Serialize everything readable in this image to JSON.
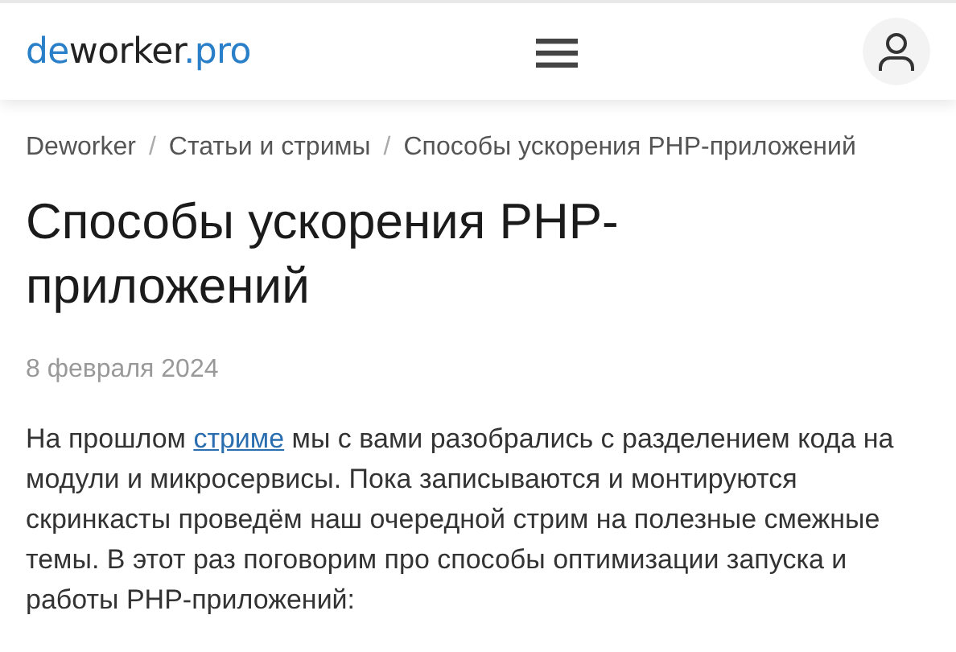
{
  "header": {
    "logo": [
      {
        "text": "de",
        "accent": true
      },
      {
        "text": "worker",
        "accent": false
      },
      {
        "text": ".pro",
        "accent": true
      }
    ]
  },
  "breadcrumb": [
    {
      "kind": "link",
      "text": "Deworker"
    },
    {
      "kind": "separator",
      "text": "/"
    },
    {
      "kind": "link",
      "text": "Статьи и стримы"
    },
    {
      "kind": "separator",
      "text": "/"
    },
    {
      "kind": "current",
      "text": "Способы ускорения PHP-приложений"
    }
  ],
  "title": "Способы ускорения PHP-приложений",
  "date": "8 февраля 2024",
  "intro": {
    "before": "На прошлом ",
    "link": "стриме",
    "after": " мы с вами разобрались с разделением кода на модули и микросервисы. Пока записываются и монтируются скринкасты проведём наш очередной стрим на полезные смежные темы. В этот раз поговорим про способы оптимизации запуска и работы PHP-приложений:"
  }
}
